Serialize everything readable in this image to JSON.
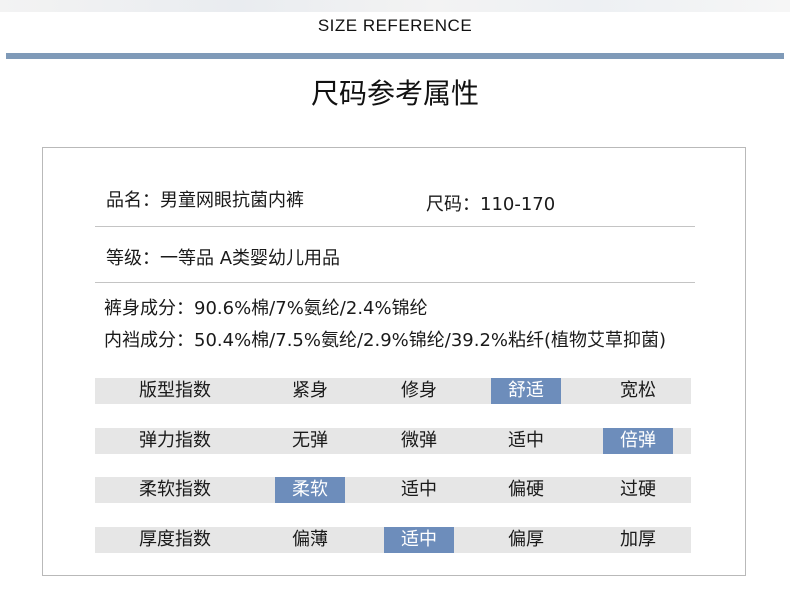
{
  "header": {
    "title": "SIZE REFERENCE",
    "accent_color": "#7f9ab8"
  },
  "section_title": "尺码参考属性",
  "info": {
    "name": "品名：男童网眼抗菌内裤",
    "size": "尺码：110-170",
    "grade": "等级：一等品 A类婴幼儿用品",
    "pants_material": "裤身成分：90.6%棉/7%氨纶/2.4%锦纶",
    "crotch_material": "内裆成分：50.4%棉/7.5%氨纶/2.9%锦纶/39.2%粘纤(植物艾草抑菌)"
  },
  "index_table": {
    "highlight_color": "#6d8dbb",
    "rows": [
      {
        "label": "版型指数",
        "options": [
          "紧身",
          "修身",
          "舒适",
          "宽松"
        ],
        "selected": "舒适"
      },
      {
        "label": "弹力指数",
        "options": [
          "无弹",
          "微弹",
          "适中",
          "倍弹"
        ],
        "selected": "倍弹"
      },
      {
        "label": "柔软指数",
        "options": [
          "柔软",
          "适中",
          "偏硬",
          "过硬"
        ],
        "selected": "柔软"
      },
      {
        "label": "厚度指数",
        "options": [
          "偏薄",
          "适中",
          "偏厚",
          "加厚"
        ],
        "selected": "适中"
      }
    ]
  }
}
